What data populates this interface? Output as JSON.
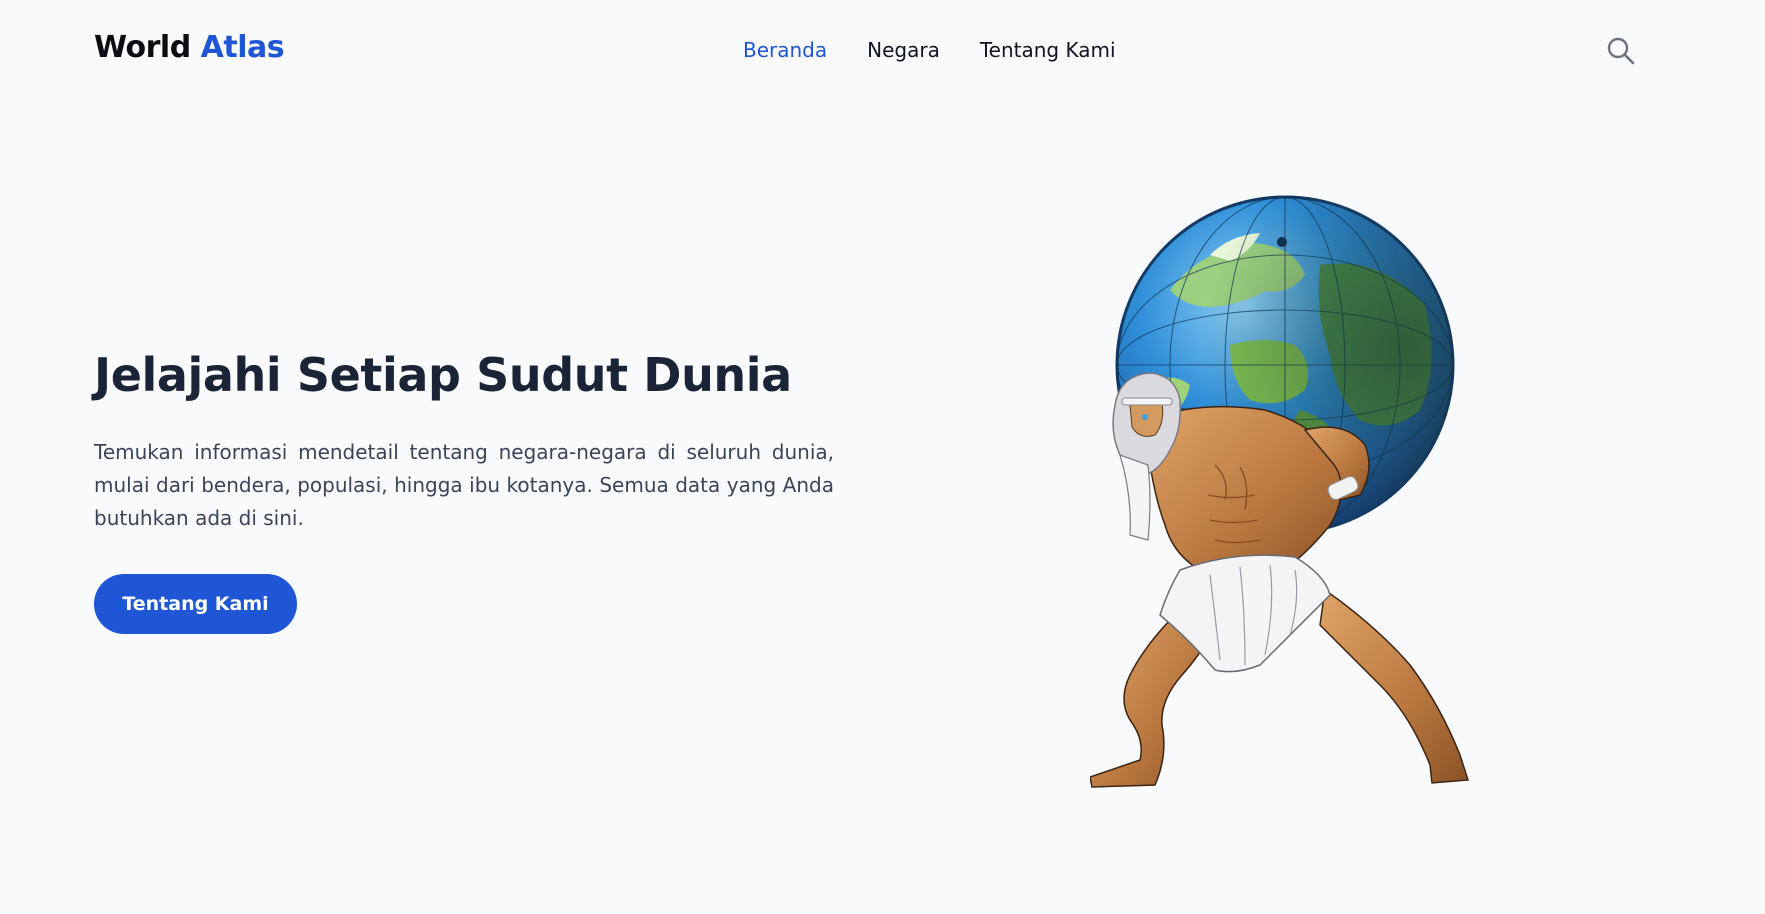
{
  "brand": {
    "name_primary": "World",
    "name_accent": "Atlas",
    "accent_color": "#1e56d6"
  },
  "nav": {
    "items": [
      {
        "label": "Beranda",
        "active": true
      },
      {
        "label": "Negara",
        "active": false
      },
      {
        "label": "Tentang Kami",
        "active": false
      }
    ]
  },
  "search": {
    "icon": "search-icon"
  },
  "hero": {
    "title": "Jelajahi Setiap Sudut Dunia",
    "description": "Temukan informasi mendetail tentang negara-negara di seluruh dunia, mulai dari bendera, populasi, hingga ibu kotanya. Semua data yang Anda butuhkan ada di sini.",
    "cta_label": "Tentang Kami",
    "illustration": "atlas-holding-globe-illustration"
  }
}
